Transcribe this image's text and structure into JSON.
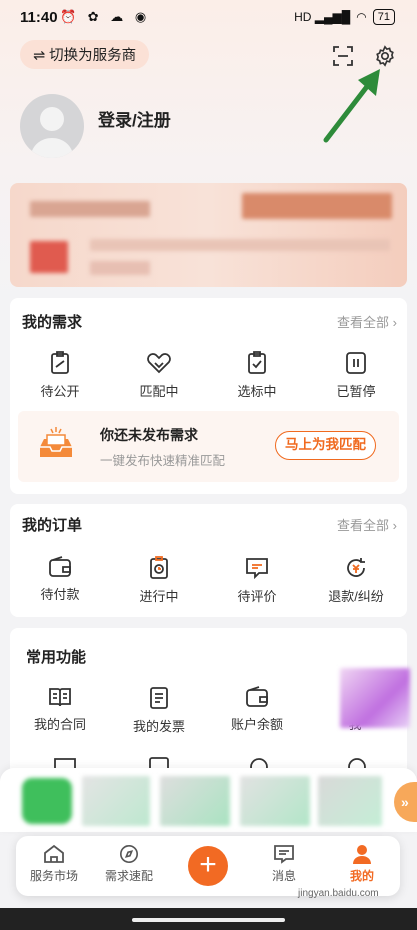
{
  "status_bar": {
    "time": "11:40",
    "battery": "71"
  },
  "header": {
    "switch_label": "⇌ 切换为服务商"
  },
  "profile": {
    "login_text": "登录/注册"
  },
  "needs": {
    "title": "我的需求",
    "see_all": "查看全部",
    "items": [
      {
        "label": "待公开",
        "icon": "doc-slash-icon"
      },
      {
        "label": "匹配中",
        "icon": "heart-handshake-icon"
      },
      {
        "label": "选标中",
        "icon": "clipboard-check-icon"
      },
      {
        "label": "已暂停",
        "icon": "pause-icon"
      }
    ],
    "empty_title": "你还未发布需求",
    "empty_sub": "一键发布快速精准匹配",
    "match_button": "马上为我匹配"
  },
  "orders": {
    "title": "我的订单",
    "see_all": "查看全部",
    "items": [
      {
        "label": "待付款",
        "icon": "wallet-icon"
      },
      {
        "label": "进行中",
        "icon": "clock-doc-icon"
      },
      {
        "label": "待评价",
        "icon": "comment-icon"
      },
      {
        "label": "退款/纠纷",
        "icon": "refund-icon"
      }
    ]
  },
  "functions": {
    "title": "常用功能",
    "items": [
      {
        "label": "我的合同",
        "icon": "book-icon"
      },
      {
        "label": "我的发票",
        "icon": "invoice-icon"
      },
      {
        "label": "账户余额",
        "icon": "wallet-icon"
      },
      {
        "label": "我",
        "icon": "more-icon"
      }
    ]
  },
  "tabs": [
    {
      "label": "服务市场",
      "icon": "home-icon"
    },
    {
      "label": "需求速配",
      "icon": "compass-icon"
    },
    {
      "label": "+",
      "icon": "plus-icon"
    },
    {
      "label": "消息",
      "icon": "message-icon"
    },
    {
      "label": "我的",
      "icon": "person-icon"
    }
  ],
  "watermark": "jingyan.baidu.com",
  "colors": {
    "accent": "#f26a23",
    "arrow": "#2e8b3a"
  }
}
